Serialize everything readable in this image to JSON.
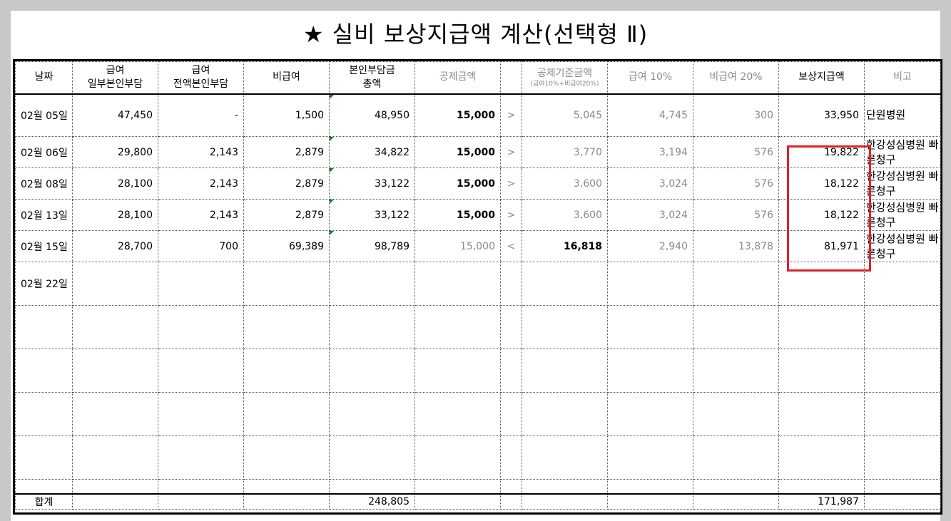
{
  "title": "★ 실비 보상지급액 계산(선택형 Ⅱ)",
  "headers": {
    "date": "날짜",
    "copay_line1": "급여",
    "copay_line2": "일부본인부담",
    "full_line1": "급여",
    "full_line2": "전액본인부담",
    "noncovered": "비급여",
    "total_line1": "본인부담금",
    "total_line2": "총액",
    "deduction": "공제금액",
    "base_line1": "공제기준금액",
    "base_line2": "(급여10%+비급여20%)",
    "cov10": "급여 10%",
    "non20": "비급여 20%",
    "payout": "보상지급액",
    "note": "비고"
  },
  "rows": [
    {
      "date": "02월 05일",
      "copay": "47,450",
      "full": "-",
      "noncovered": "1,500",
      "total": "48,950",
      "deduction": "15,000",
      "cmp": ">",
      "base": "5,045",
      "cov10": "4,745",
      "non20": "300",
      "payout": "33,950",
      "note": "단원병원"
    },
    {
      "date": "02월 06일",
      "copay": "29,800",
      "full": "2,143",
      "noncovered": "2,879",
      "total": "34,822",
      "deduction": "15,000",
      "cmp": ">",
      "base": "3,770",
      "cov10": "3,194",
      "non20": "576",
      "payout": "19,822",
      "note": "한강성심병원 빠른청구"
    },
    {
      "date": "02월 08일",
      "copay": "28,100",
      "full": "2,143",
      "noncovered": "2,879",
      "total": "33,122",
      "deduction": "15,000",
      "cmp": ">",
      "base": "3,600",
      "cov10": "3,024",
      "non20": "576",
      "payout": "18,122",
      "note": "한강성심병원 빠른청구"
    },
    {
      "date": "02월 13일",
      "copay": "28,100",
      "full": "2,143",
      "noncovered": "2,879",
      "total": "33,122",
      "deduction": "15,000",
      "cmp": ">",
      "base": "3,600",
      "cov10": "3,024",
      "non20": "576",
      "payout": "18,122",
      "note": "한강성심병원 빠른청구"
    },
    {
      "date": "02월 15일",
      "copay": "28,700",
      "full": "700",
      "noncovered": "69,389",
      "total": "98,789",
      "deduction": "15,000",
      "cmp": "<",
      "base": "16,818",
      "cov10": "2,940",
      "non20": "13,878",
      "payout": "81,971",
      "note": "한강성심병원 빠른청구"
    },
    {
      "date": "02월 22일"
    }
  ],
  "totals": {
    "label": "합계",
    "total": "248,805",
    "payout": "171,987"
  },
  "colors": {
    "highlight": "#e0212a",
    "muted_text": "#8a8a8a",
    "corner_marker": "#1a7f1a"
  }
}
